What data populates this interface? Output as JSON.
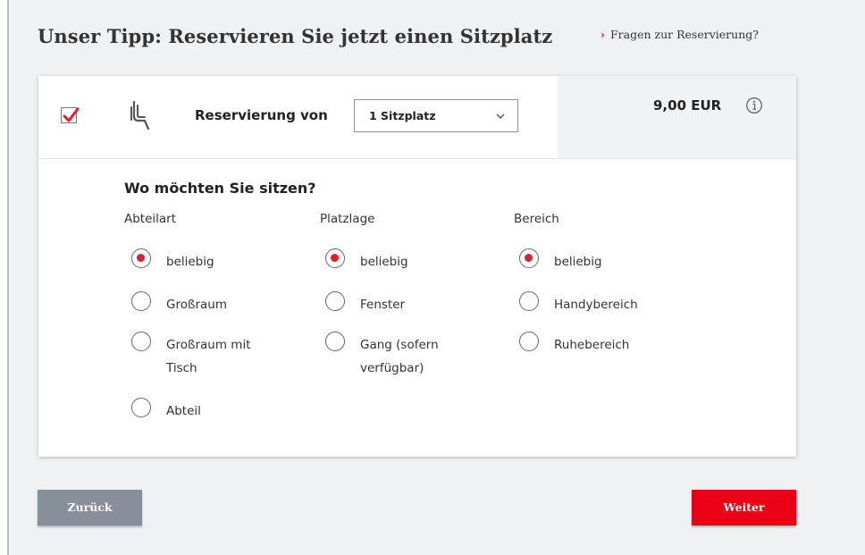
{
  "page": {
    "title": "Unser Tipp: Reservieren Sie jetzt einen Sitzplatz",
    "faq_link": "Fragen zur Reservierung?"
  },
  "reservation": {
    "checked": true,
    "label": "Reservierung von",
    "select_value": "1 Sitzplatz",
    "price": "9,00 EUR",
    "seat_icon": "seat-icon",
    "info_icon": "info-icon"
  },
  "preferences": {
    "question": "Wo möchten Sie sitzen?",
    "columns": [
      {
        "heading": "Abteilart",
        "options": [
          {
            "label": "beliebig",
            "selected": true
          },
          {
            "label": "Großraum",
            "selected": false
          },
          {
            "label": "Großraum mit Tisch",
            "selected": false
          },
          {
            "label": "Abteil",
            "selected": false
          }
        ]
      },
      {
        "heading": "Platzlage",
        "options": [
          {
            "label": "beliebig",
            "selected": true
          },
          {
            "label": "Fenster",
            "selected": false
          },
          {
            "label": "Gang (sofern verfügbar)",
            "selected": false
          }
        ]
      },
      {
        "heading": "Bereich",
        "options": [
          {
            "label": "beliebig",
            "selected": true
          },
          {
            "label": "Handybereich",
            "selected": false
          },
          {
            "label": "Ruhebereich",
            "selected": false
          }
        ]
      }
    ]
  },
  "buttons": {
    "back": "Zurück",
    "next": "Weiter"
  },
  "colors": {
    "accent": "#e41e26",
    "button_next": "#ec0016",
    "button_back": "#878f9b"
  }
}
